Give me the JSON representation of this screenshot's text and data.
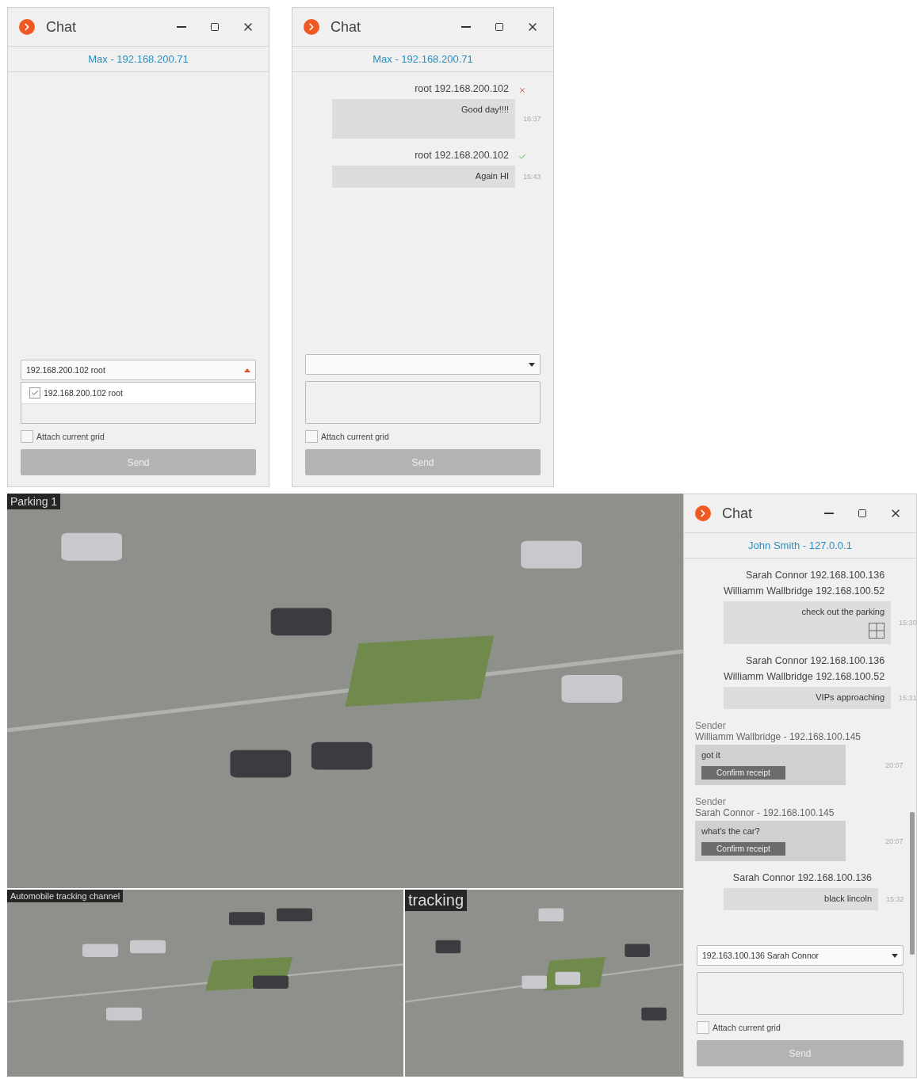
{
  "chat_windows": [
    {
      "title": "Chat",
      "contact": "Max - 192.168.200.71",
      "recipient": {
        "value": "192.168.200.102 root",
        "expanded": true,
        "options": [
          {
            "label": "192.168.200.102 root",
            "checked": true
          }
        ]
      },
      "attach_grid": {
        "label": "Attach current grid",
        "checked": false
      },
      "send_button": "Send"
    },
    {
      "title": "Chat",
      "contact": "Max - 192.168.200.71",
      "messages": [
        {
          "kind": "outgoing",
          "recipients": [
            "root 192.168.200.102"
          ],
          "delivered": false,
          "text": "Good day!!!!",
          "time": "16:37",
          "tall": true
        },
        {
          "kind": "outgoing",
          "recipients": [
            "root 192.168.200.102"
          ],
          "delivered": true,
          "text": "Again HI",
          "time": "16:43",
          "tall": false
        }
      ],
      "recipient": {
        "expanded": false
      },
      "attach_grid": {
        "label": "Attach current grid",
        "checked": false
      },
      "send_button": "Send"
    },
    {
      "title": "Chat",
      "contact": "John Smith - 127.0.0.1",
      "messages": [
        {
          "kind": "outgoing",
          "recipients": [
            "Sarah Connor 192.168.100.136",
            "Williamm Wallbridge 192.168.100.52"
          ],
          "text": "check out the parking",
          "time": "15:30",
          "grid_attached": true,
          "tall": true
        },
        {
          "kind": "outgoing",
          "recipients": [
            "Sarah Connor 192.168.100.136",
            "Williamm Wallbridge 192.168.100.52"
          ],
          "text": "VIPs approaching",
          "time": "15:31",
          "tall": false
        },
        {
          "kind": "incoming",
          "sender_label": "Sender",
          "sender": "Williamm Wallbridge - 192.168.100.145",
          "text": "got it",
          "button": "Confirm receipt",
          "time": "20:07"
        },
        {
          "kind": "incoming",
          "sender_label": "Sender",
          "sender": "Sarah Connor - 192.168.100.145",
          "text": "what's the car?",
          "button": "Confirm receipt",
          "time": "20:07"
        },
        {
          "kind": "outgoing",
          "recipients": [
            "Sarah Connor 192.168.100.136"
          ],
          "text": "black lincoln",
          "time": "15:32",
          "tall": false
        }
      ],
      "recipient": {
        "value": "192.163.100.136 Sarah Connor",
        "expanded": false
      },
      "attach_grid": {
        "label": "Attach current grid",
        "checked": false
      },
      "send_button": "Send"
    }
  ],
  "video_tiles": [
    {
      "title": "Parking 1"
    },
    {
      "title": "Automobile tracking channel"
    },
    {
      "title": "tracking"
    }
  ]
}
